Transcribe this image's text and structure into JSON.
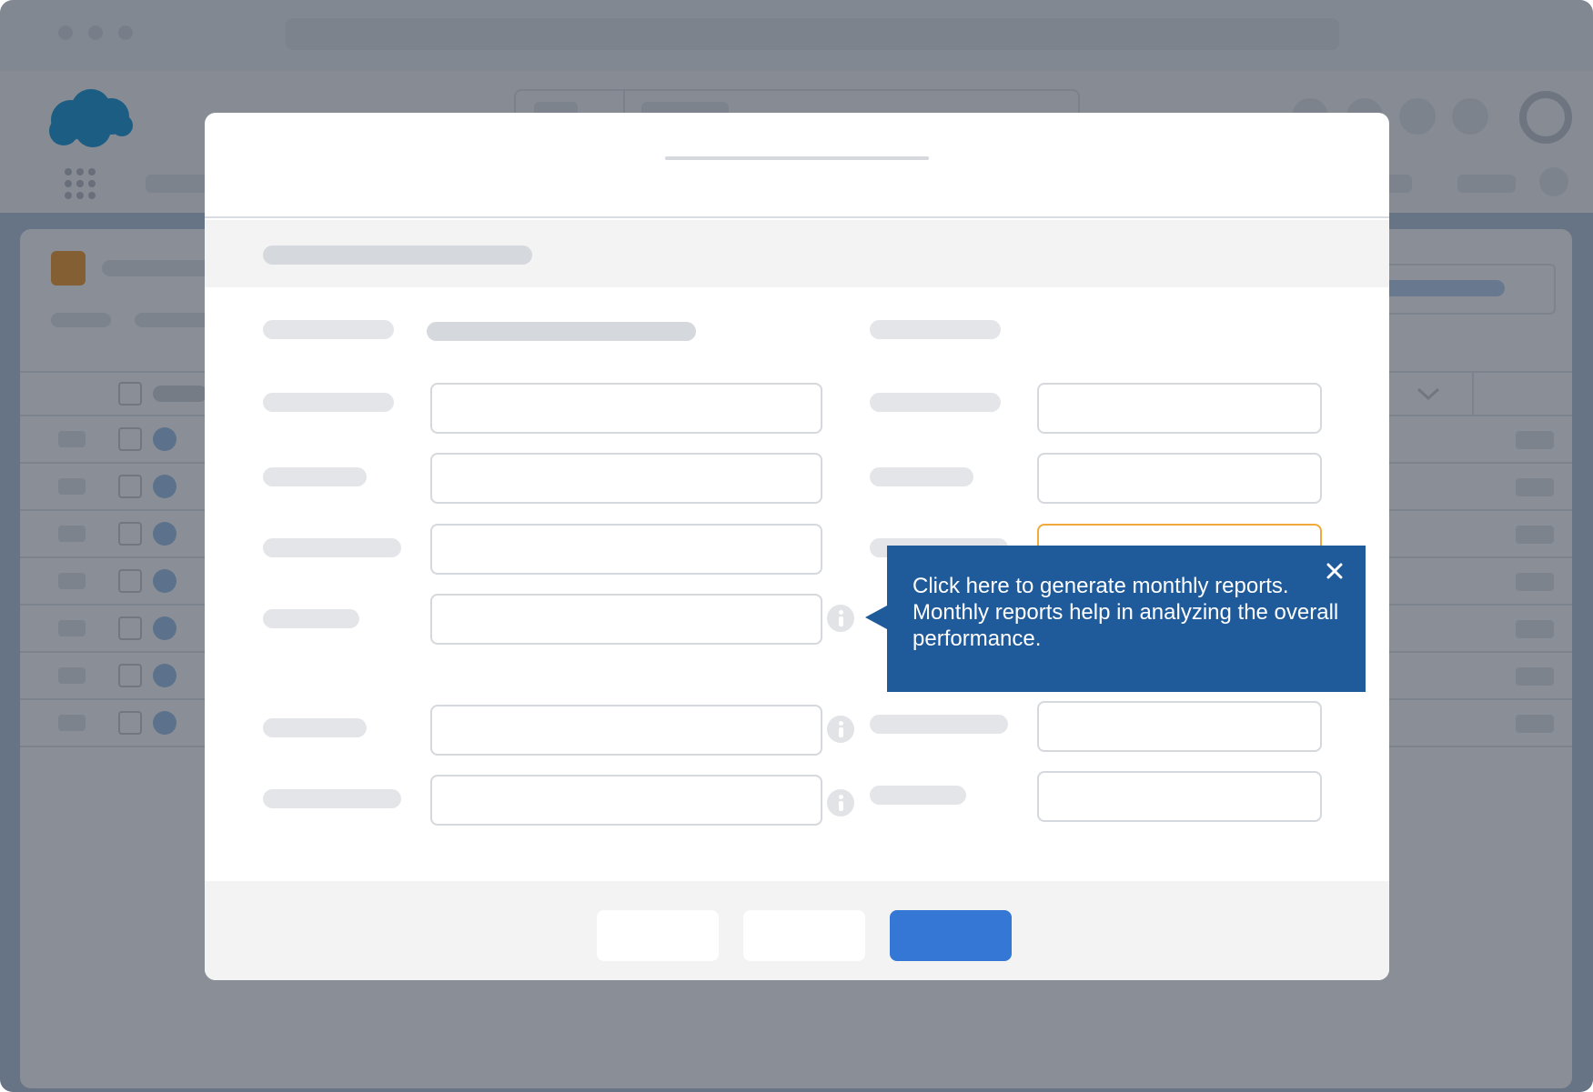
{
  "tooltip": {
    "message": "Click here to generate monthly reports. Monthly reports help in analyzing the overall performance.",
    "close_icon": "close-icon",
    "background_color": "#1f5b9a"
  },
  "colors": {
    "brand_logo": "#1b96d6",
    "app_icon": "#f29b2f",
    "primary_button": "#3577d4",
    "highlighted_field_border": "#f2a93b"
  },
  "icons": [
    "cloud-logo-icon",
    "app-launcher-grid-icon",
    "avatar-icon",
    "info-icon",
    "checkbox-icon",
    "close-icon"
  ]
}
